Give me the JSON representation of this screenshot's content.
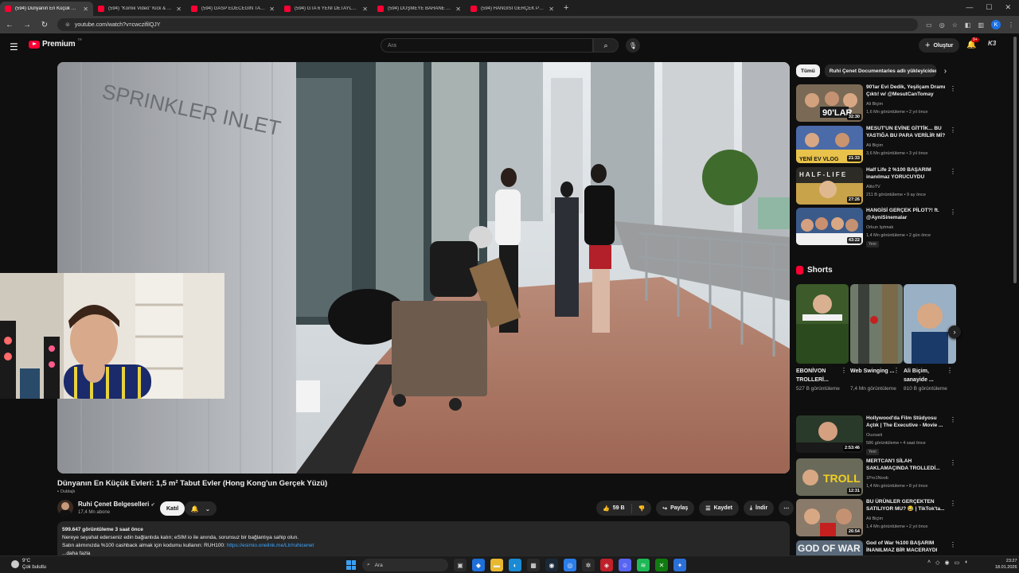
{
  "browser": {
    "tabs": [
      {
        "title": "(594) Dünyanın En Küçük Evleri",
        "active": true
      },
      {
        "title": "(594) \"Komik Video\" Kick & Tw",
        "active": false
      },
      {
        "title": "(594) GASP EDECEĞİN TAKSİDE",
        "active": false
      },
      {
        "title": "(594) GTA 6 YENİ DETAYLAR SI",
        "active": false
      },
      {
        "title": "(594) DÜŞMEYE BAHANE ARAM",
        "active": false
      },
      {
        "title": "(594) HANGİSİ GERÇEK PİLOT?",
        "active": false
      }
    ],
    "url": "youtube.com/watch?v=cwczifilQJY"
  },
  "header": {
    "logo_text": "Premium",
    "country_code": "TR",
    "search_placeholder": "Ara",
    "create_label": "Oluştur",
    "notif_badge": "9+"
  },
  "video": {
    "title": "Dünyanın En Küçük Evleri: 1,5 m² Tabut Evler (Hong Kong'un Gerçek Yüzü)",
    "dub_label": "Dublajlı",
    "channel_name": "Ruhi Çenet Belgeselleri",
    "subscribers": "17,4 Mn abone",
    "join_label": "Katıl",
    "likes": "59 B",
    "share_label": "Paylaş",
    "save_label": "Kaydet",
    "download_label": "İndir",
    "desc_stats": "599.647 görüntüleme  3 saat önce",
    "desc_line1": "Nereye seyahat ederseniz edin bağlantıda kalın; eSIM io ile anında, sorunsuz bir bağlantıya sahip olun.",
    "desc_line2_prefix": "Satın alımınızda %100 cashback almak için kodumu kullanın: RUH100:",
    "desc_link": "https://esimio.onelink.me/Ltr/ruhicenet",
    "desc_more": "...daha fazla"
  },
  "sidebar": {
    "chips": [
      {
        "label": "Tümü",
        "active": true
      },
      {
        "label": "Ruhi Çenet Documentaries adlı yükleyiciden",
        "active": false
      }
    ],
    "recs_top": [
      {
        "title": "90'lar Evi Dedik, Yeşilçam Dramı Çıktı! w/ @MesutCanTomay",
        "channel": "Ali Biçim",
        "meta": "1,6 Mn görüntüleme • 2 yıl önce",
        "duration": "32:30",
        "new": ""
      },
      {
        "title": "MESUT'UN EVİNE GİTTİK... BU YASTIĞA BU PARA VERİLİR Mİ?",
        "channel": "Ali Biçim",
        "meta": "3,6 Mn görüntüleme • 3 yıl önce",
        "duration": "21:33",
        "new": ""
      },
      {
        "title": "Half Life 2 %100 BAŞARIM inanılmaz YORUCUYDU",
        "channel": "AlitoTV",
        "meta": "211 B görüntüleme • 9 ay önce",
        "duration": "27:26",
        "new": ""
      },
      {
        "title": "HANGİSİ GERÇEK PİLOT?! ft. @AyniSinemalar",
        "channel": "Orkun Işıtmak",
        "meta": "1,4 Mn görüntüleme • 2 gün önce",
        "duration": "43:22",
        "new": "Yeni"
      }
    ],
    "shorts_heading": "Shorts",
    "shorts": [
      {
        "title": "EBONİVON TROLLERİ...",
        "views": "527 B görüntüleme"
      },
      {
        "title": "Web Swinging ...",
        "views": "7,4 Mn görüntüleme"
      },
      {
        "title": "Ali Biçim, sanayide ...",
        "views": "810 B görüntüleme"
      }
    ],
    "recs_bottom": [
      {
        "title": "Hollywood'da Film Stüdyosu Açtık | The Executive - Movie ...",
        "channel": "Ouzsarii",
        "meta": "586 görüntüleme • 4 saat önce",
        "duration": "2:53:46",
        "new": "Yeni"
      },
      {
        "title": "MERTCAN'I SİLAH SAKLAMAÇINDA TROLLEDİ...",
        "channel": "1Pro1Noob",
        "meta": "1,4 Mn görüntüleme • 8 yıl önce",
        "duration": "12:31",
        "new": ""
      },
      {
        "title": "BU ÜRÜNLER GERÇEKTEN SATILIYOR MU? 😂 | TikTok'ta...",
        "channel": "Ali Biçim",
        "meta": "1,4 Mn görüntüleme • 2 yıl önce",
        "duration": "26:54",
        "new": ""
      },
      {
        "title": "God of War %100 BAŞARIM İNANILMAZ BİR MACERAYDI",
        "channel": "",
        "meta": "",
        "duration": "",
        "new": ""
      }
    ]
  },
  "taskbar": {
    "temp": "9°C",
    "weather": "Çok bulutlu",
    "search": "Ara",
    "time": "23:27",
    "date": "18.01.2026"
  },
  "colors": {
    "accent": "#ff0033",
    "link": "#3ea6ff",
    "bg": "#0f0f0f"
  }
}
